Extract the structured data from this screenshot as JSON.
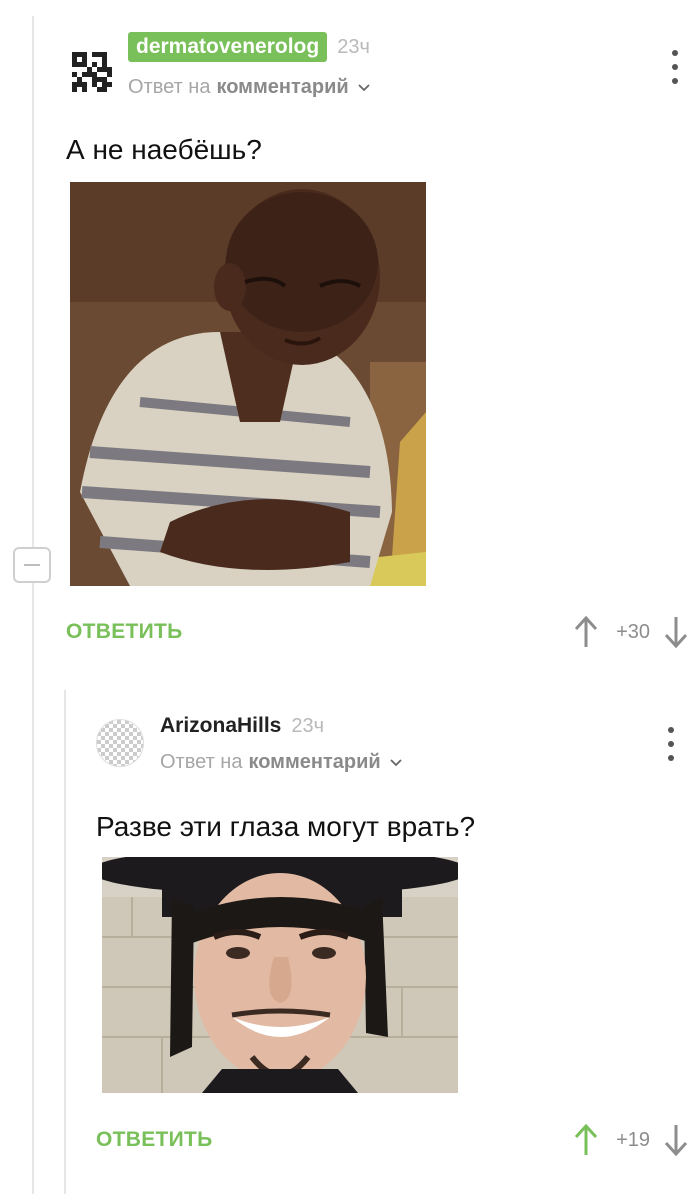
{
  "comments": [
    {
      "author": "dermatovenerolog",
      "time": "23ч",
      "reply_prefix": "Ответ на",
      "reply_target": "комментарий",
      "text": "А не наебёшь?",
      "avatar_icon": "qr-code-avatar",
      "image_alt": "meme-toddler-skeptical",
      "reply_label": "ОТВЕТИТЬ",
      "score": "+30",
      "upvoted": false
    },
    {
      "author": "ArizonaHills",
      "time": "23ч",
      "reply_prefix": "Ответ на",
      "reply_target": "комментарий",
      "text": "Разве эти глаза могут врать?",
      "avatar_icon": "placeholder-avatar",
      "image_alt": "smiling-man-hat",
      "reply_label": "ОТВЕТИТЬ",
      "score": "+19",
      "upvoted": true
    }
  ],
  "colors": {
    "accent": "#79c05a",
    "muted": "#a6a6a6",
    "vote_neutral": "#8d8d8d",
    "vote_active": "#79c05a"
  }
}
